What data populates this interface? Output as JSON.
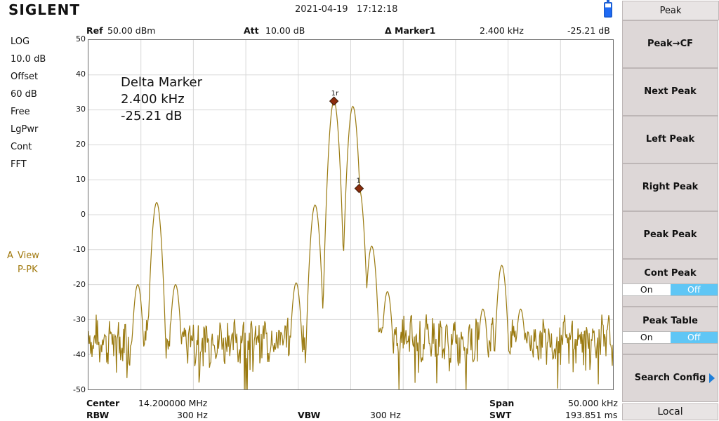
{
  "brand": "SIGLENT",
  "status": {
    "date": "2021-04-19",
    "time": "17:12:18"
  },
  "header": {
    "ref_label": "Ref",
    "ref_value": "50.00 dBm",
    "att_label": "Att",
    "att_value": "10.00 dB",
    "marker_label": "Δ Marker1",
    "marker_freq": "2.400 kHz",
    "marker_level": "-25.21 dB"
  },
  "left_panel": {
    "items": [
      "LOG",
      "10.0 dB",
      "Offset",
      "60 dB",
      "Free",
      "LgPwr",
      "Cont",
      "FFT"
    ],
    "trace_letter": "A",
    "trace_view": "View",
    "trace_detector": "P-PK"
  },
  "annotation": {
    "title": "Delta Marker",
    "freq": "2.400 kHz",
    "level": "-25.21 dB"
  },
  "markers": [
    {
      "label": "1r",
      "x_khz": -1.6,
      "y_db": 32.5
    },
    {
      "label": "1",
      "x_khz": 0.8,
      "y_db": 7.5
    }
  ],
  "bottom": {
    "center_label": "Center",
    "center_value": "14.200000 MHz",
    "rbw_label": "RBW",
    "rbw_value": "300 Hz",
    "vbw_label": "VBW",
    "vbw_value": "300 Hz",
    "span_label": "Span",
    "span_value": "50.000 kHz",
    "swt_label": "SWT",
    "swt_value": "193.851 ms"
  },
  "softkeys": {
    "title": "Peak",
    "peak_cf": "Peak→CF",
    "next_peak": "Next Peak",
    "left_peak": "Left Peak",
    "right_peak": "Right Peak",
    "peak_peak": "Peak Peak",
    "cont_peak": "Cont Peak",
    "cont_peak_on": "On",
    "cont_peak_off": "Off",
    "peak_table": "Peak Table",
    "peak_table_on": "On",
    "peak_table_off": "Off",
    "search_config": "Search Config",
    "local": "Local"
  },
  "colors": {
    "trace": "#9a7a10",
    "grid": "#d8d8d8",
    "accent": "#5fc6f5",
    "marker": "#8b2c0c"
  },
  "chart_data": {
    "type": "line",
    "yticks": [
      "50",
      "40",
      "30",
      "20",
      "10",
      "0",
      "-10",
      "-20",
      "-30",
      "-40",
      "-50"
    ],
    "ylim": [
      -50,
      50
    ],
    "xlim_khz": [
      -25,
      25
    ],
    "peaks": [
      {
        "x": -18.5,
        "y": 3.5
      },
      {
        "x": -20.3,
        "y": -20
      },
      {
        "x": -16.7,
        "y": -20
      },
      {
        "x": -5.2,
        "y": -19.5
      },
      {
        "x": -3.4,
        "y": 2.8
      },
      {
        "x": -1.6,
        "y": 32.5
      },
      {
        "x": 0.2,
        "y": 31
      },
      {
        "x": 0.8,
        "y": 7.5
      },
      {
        "x": 2.0,
        "y": -9
      },
      {
        "x": 3.5,
        "y": -22
      },
      {
        "x": 14.4,
        "y": -14.5
      },
      {
        "x": 12.6,
        "y": -27
      },
      {
        "x": 16.2,
        "y": -27
      }
    ],
    "noise_floor": -36
  }
}
